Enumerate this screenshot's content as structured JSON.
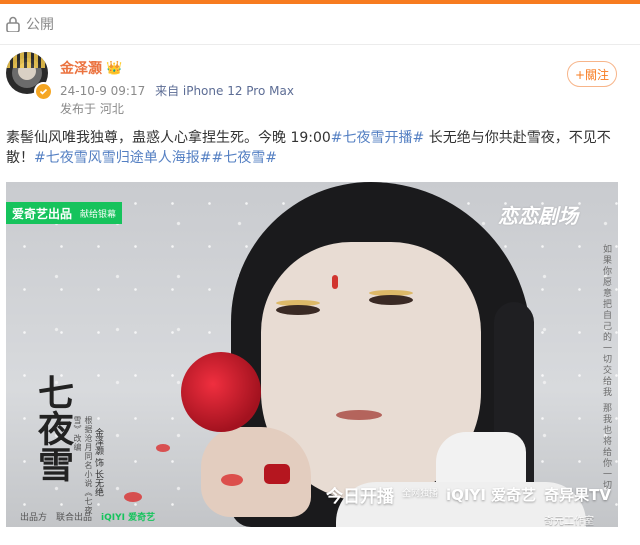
{
  "header": {
    "privacy_label": "公開",
    "lock_icon": "lock-icon"
  },
  "author": {
    "name": "金泽灏",
    "crown": "👑",
    "date": "24-10-9 09:17",
    "source": "来自 iPhone 12 Pro Max",
    "location": "发布于 河北",
    "verified_color": "#f5a623",
    "name_color": "#eb7340"
  },
  "follow_button": {
    "label": "+關注"
  },
  "post": {
    "text_1": "素髻仙风唯我独尊，蛊惑人心拿捏生死。今晚 19:00",
    "tag_1": "#七夜雪开播#",
    "text_2": " 长无绝与你共赴雪夜，不见不散！",
    "tag_2": "#七夜雪风雪归途单人海报#",
    "tag_3": "#七夜雪#",
    "tag_color": "#5580c3"
  },
  "poster": {
    "brand_left": "爱奇艺出品",
    "brand_left_sub": "献给银幕",
    "channel_logo": "恋恋剧场",
    "poem": "如果你愿意把自己的一切交给我 那我也将给你一切",
    "title": "七夜雪",
    "sub_note": "根据沧月同名小说《七夜雪》改编",
    "actor": "金泽灏 饰 长无绝",
    "footer_logos": [
      "出品方",
      "联合出品",
      "iQIYI 爱奇艺"
    ],
    "airing_label": "今日开播",
    "airing_small": "全网独播",
    "iqiyi": "iQIYI 爱奇艺",
    "qiyiguo": "奇异果TV",
    "studio": "奇元工作室"
  }
}
